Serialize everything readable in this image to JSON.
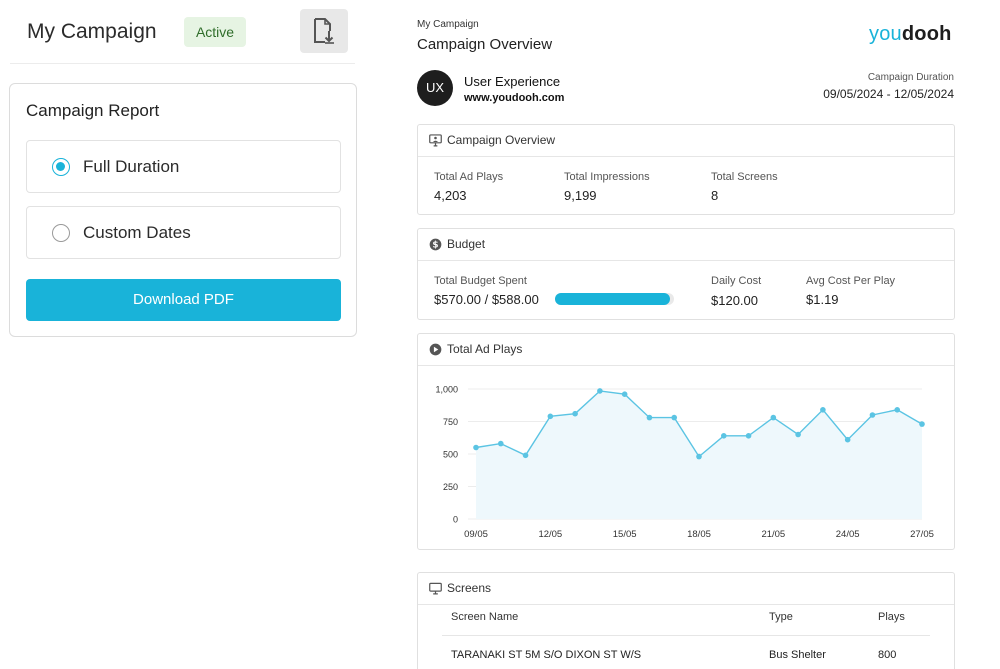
{
  "header": {
    "title": "My Campaign",
    "status": "Active",
    "download_icon": "file-download-icon"
  },
  "report_panel": {
    "title": "Campaign Report",
    "options": [
      {
        "label": "Full Duration",
        "selected": true
      },
      {
        "label": "Custom Dates",
        "selected": false
      }
    ],
    "download_label": "Download PDF"
  },
  "report": {
    "small_title": "My Campaign",
    "title": "Campaign Overview",
    "logo": {
      "you": "you",
      "dooh": "dooh"
    },
    "client": {
      "initials": "UX",
      "name": "User Experience",
      "url": "www.youdooh.com"
    },
    "duration": {
      "label": "Campaign Duration",
      "value": "09/05/2024  -  12/05/2024"
    },
    "colors": {
      "accent": "#19b3d9",
      "line": "#5bc4e3",
      "area": "#eef8fc"
    }
  },
  "overview": {
    "title": "Campaign Overview",
    "icon": "monitor-people-icon",
    "stats": [
      {
        "label": "Total Ad Plays",
        "value": "4,203"
      },
      {
        "label": "Total Impressions",
        "value": "9,199"
      },
      {
        "label": "Total Screens",
        "value": "8"
      }
    ]
  },
  "budget": {
    "title": "Budget",
    "icon": "dollar-circle-icon",
    "spent_label": "Total Budget Spent",
    "spent_value": "$570.00 / $588.00",
    "spent_fraction": 0.969,
    "daily_label": "Daily Cost",
    "daily_value": "$120.00",
    "avg_label": "Avg Cost Per Play",
    "avg_value": "$1.19"
  },
  "plays": {
    "title": "Total Ad Plays",
    "icon": "play-circle-icon"
  },
  "chart_data": {
    "type": "area",
    "title": "Total Ad Plays",
    "xlabel": "",
    "ylabel": "",
    "ylim": [
      0,
      1000
    ],
    "y_ticks": [
      "0",
      "250",
      "500",
      "750",
      "1,000"
    ],
    "x_tick_labels": [
      "09/05",
      "12/05",
      "15/05",
      "18/05",
      "21/05",
      "24/05",
      "27/05"
    ],
    "grid": true,
    "series": [
      {
        "values": [
          550,
          580,
          490,
          790,
          810,
          985,
          960,
          780,
          780,
          480,
          640,
          640,
          780,
          650,
          840,
          610,
          800,
          840,
          730
        ]
      }
    ]
  },
  "screens": {
    "title": "Screens",
    "icon": "monitor-icon",
    "columns": [
      "Screen Name",
      "Type",
      "Plays"
    ],
    "rows": [
      [
        "TARANAKI ST 5M S/O DIXON ST W/S",
        "Bus Shelter",
        "800"
      ]
    ]
  }
}
